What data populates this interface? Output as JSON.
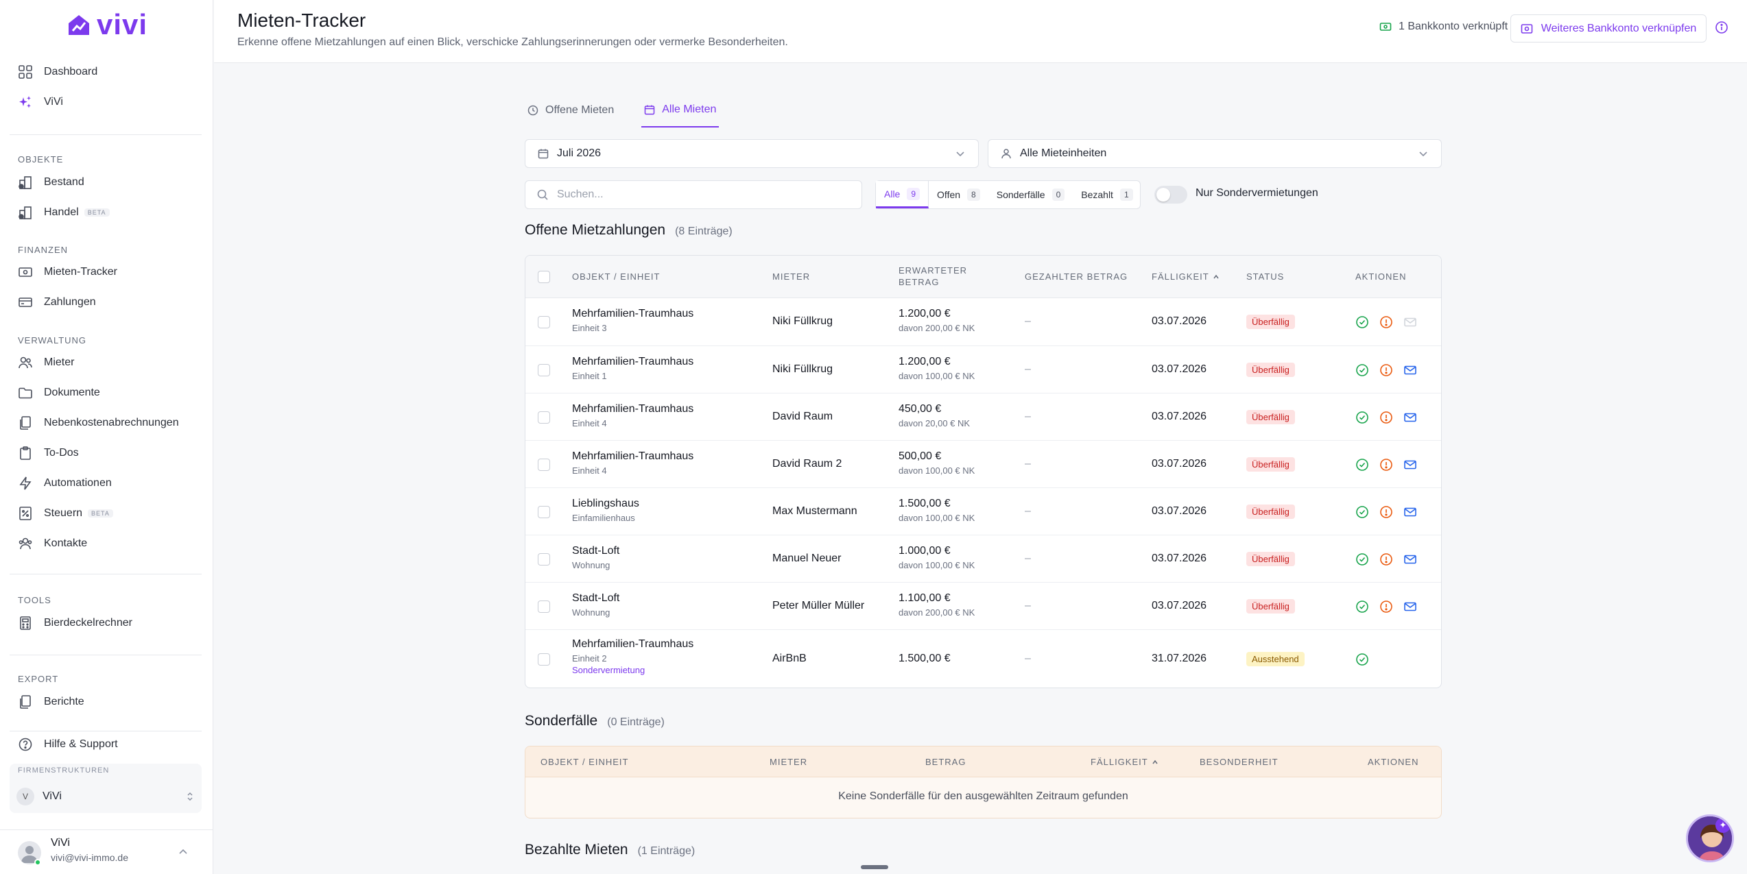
{
  "app": {
    "logo_text": "vivi",
    "brand_color": "#7c3aed"
  },
  "sidebar": {
    "top_items": [
      {
        "label": "Dashboard",
        "icon": "grid-icon"
      },
      {
        "label": "ViVi",
        "icon": "sparkles-icon"
      }
    ],
    "sections": [
      {
        "title": "OBJEKTE",
        "items": [
          {
            "label": "Bestand",
            "icon": "buildings-icon"
          },
          {
            "label": "Handel",
            "icon": "buildings-icon",
            "badge": "BETA"
          }
        ]
      },
      {
        "title": "FINANZEN",
        "items": [
          {
            "label": "Mieten-Tracker",
            "icon": "money-icon"
          },
          {
            "label": "Zahlungen",
            "icon": "card-icon"
          }
        ]
      },
      {
        "title": "VERWALTUNG",
        "items": [
          {
            "label": "Mieter",
            "icon": "users-icon"
          },
          {
            "label": "Dokumente",
            "icon": "folder-icon"
          },
          {
            "label": "Nebenkostenabrechnungen",
            "icon": "documents-icon"
          },
          {
            "label": "To-Dos",
            "icon": "clipboard-icon"
          },
          {
            "label": "Automationen",
            "icon": "bolt-icon"
          },
          {
            "label": "Steuern",
            "icon": "tax-icon",
            "badge": "BETA"
          },
          {
            "label": "Kontakte",
            "icon": "contacts-icon"
          }
        ]
      },
      {
        "title": "TOOLS",
        "items": [
          {
            "label": "Bierdeckelrechner",
            "icon": "calculator-icon"
          }
        ]
      },
      {
        "title": "EXPORT",
        "items": [
          {
            "label": "Berichte",
            "icon": "report-icon"
          }
        ]
      }
    ],
    "help": "Hilfe & Support",
    "workspace": {
      "label": "FIRMENSTRUKTUREN",
      "initial": "V",
      "name": "ViVi"
    },
    "user": {
      "name": "ViVi",
      "email": "vivi@vivi-immo.de"
    }
  },
  "header": {
    "title": "Mieten-Tracker",
    "subtitle": "Erkenne offene Mietzahlungen auf einen Blick, verschicke Zahlungserinnerungen oder vermerke Besonderheiten.",
    "bank_status": "1 Bankkonto verknüpft",
    "bank_button": "Weiteres Bankkonto verknüpfen"
  },
  "tabs": [
    {
      "label": "Offene Mieten",
      "active": false
    },
    {
      "label": "Alle Mieten",
      "active": true
    }
  ],
  "filters": {
    "month": "Juli 2026",
    "units": "Alle Mieteinheiten",
    "search_placeholder": "Suchen...",
    "chips": [
      {
        "label": "Alle",
        "count": "9",
        "active": true
      },
      {
        "label": "Offen",
        "count": "8",
        "active": false
      },
      {
        "label": "Sonderfälle",
        "count": "0",
        "active": false
      },
      {
        "label": "Bezahlt",
        "count": "1",
        "active": false
      }
    ],
    "toggle_label": "Nur Sondervermietungen"
  },
  "open_section": {
    "title": "Offene Mietzahlungen",
    "count": "(8 Einträge)",
    "columns": [
      "OBJEKT / EINHEIT",
      "MIETER",
      "ERWARTETER BETRAG",
      "GEZAHLTER BETRAG",
      "FÄLLIGKEIT",
      "STATUS",
      "AKTIONEN"
    ],
    "rows": [
      {
        "objekt": "Mehrfamilien-Traumhaus",
        "einheit": "Einheit 3",
        "tag": "",
        "mieter": "Niki Füllkrug",
        "betrag": "1.200,00 €",
        "nk": "davon 200,00 € NK",
        "gezahlt": "–",
        "faellig": "03.07.2026",
        "status": "Überfällig",
        "status_type": "red",
        "mail_enabled": false
      },
      {
        "objekt": "Mehrfamilien-Traumhaus",
        "einheit": "Einheit 1",
        "tag": "",
        "mieter": "Niki Füllkrug",
        "betrag": "1.200,00 €",
        "nk": "davon 100,00 € NK",
        "gezahlt": "–",
        "faellig": "03.07.2026",
        "status": "Überfällig",
        "status_type": "red",
        "mail_enabled": true
      },
      {
        "objekt": "Mehrfamilien-Traumhaus",
        "einheit": "Einheit 4",
        "tag": "",
        "mieter": "David Raum",
        "betrag": "450,00 €",
        "nk": "davon 20,00 € NK",
        "gezahlt": "–",
        "faellig": "03.07.2026",
        "status": "Überfällig",
        "status_type": "red",
        "mail_enabled": true
      },
      {
        "objekt": "Mehrfamilien-Traumhaus",
        "einheit": "Einheit 4",
        "tag": "",
        "mieter": "David Raum 2",
        "betrag": "500,00 €",
        "nk": "davon 100,00 € NK",
        "gezahlt": "–",
        "faellig": "03.07.2026",
        "status": "Überfällig",
        "status_type": "red",
        "mail_enabled": true
      },
      {
        "objekt": "Lieblingshaus",
        "einheit": "Einfamilienhaus",
        "tag": "",
        "mieter": "Max Mustermann",
        "betrag": "1.500,00 €",
        "nk": "davon 100,00 € NK",
        "gezahlt": "–",
        "faellig": "03.07.2026",
        "status": "Überfällig",
        "status_type": "red",
        "mail_enabled": true
      },
      {
        "objekt": "Stadt-Loft",
        "einheit": "Wohnung",
        "tag": "",
        "mieter": "Manuel Neuer",
        "betrag": "1.000,00 €",
        "nk": "davon 100,00 € NK",
        "gezahlt": "–",
        "faellig": "03.07.2026",
        "status": "Überfällig",
        "status_type": "red",
        "mail_enabled": true
      },
      {
        "objekt": "Stadt-Loft",
        "einheit": "Wohnung",
        "tag": "",
        "mieter": "Peter Müller Müller",
        "betrag": "1.100,00 €",
        "nk": "davon 200,00 € NK",
        "gezahlt": "–",
        "faellig": "03.07.2026",
        "status": "Überfällig",
        "status_type": "red",
        "mail_enabled": true
      },
      {
        "objekt": "Mehrfamilien-Traumhaus",
        "einheit": "Einheit 2",
        "tag": "Sondervermietung",
        "mieter": "AirBnB",
        "betrag": "1.500,00 €",
        "nk": "",
        "gezahlt": "–",
        "faellig": "31.07.2026",
        "status": "Ausstehend",
        "status_type": "yellow",
        "mail_enabled": false
      }
    ]
  },
  "special_section": {
    "title": "Sonderfälle",
    "count": "(0 Einträge)",
    "columns": [
      "OBJEKT / EINHEIT",
      "MIETER",
      "BETRAG",
      "FÄLLIGKEIT",
      "BESONDERHEIT",
      "AKTIONEN"
    ],
    "empty": "Keine Sonderfälle für den ausgewählten Zeitraum gefunden"
  },
  "paid_section": {
    "title": "Bezahlte Mieten",
    "count": "(1 Einträge)"
  }
}
